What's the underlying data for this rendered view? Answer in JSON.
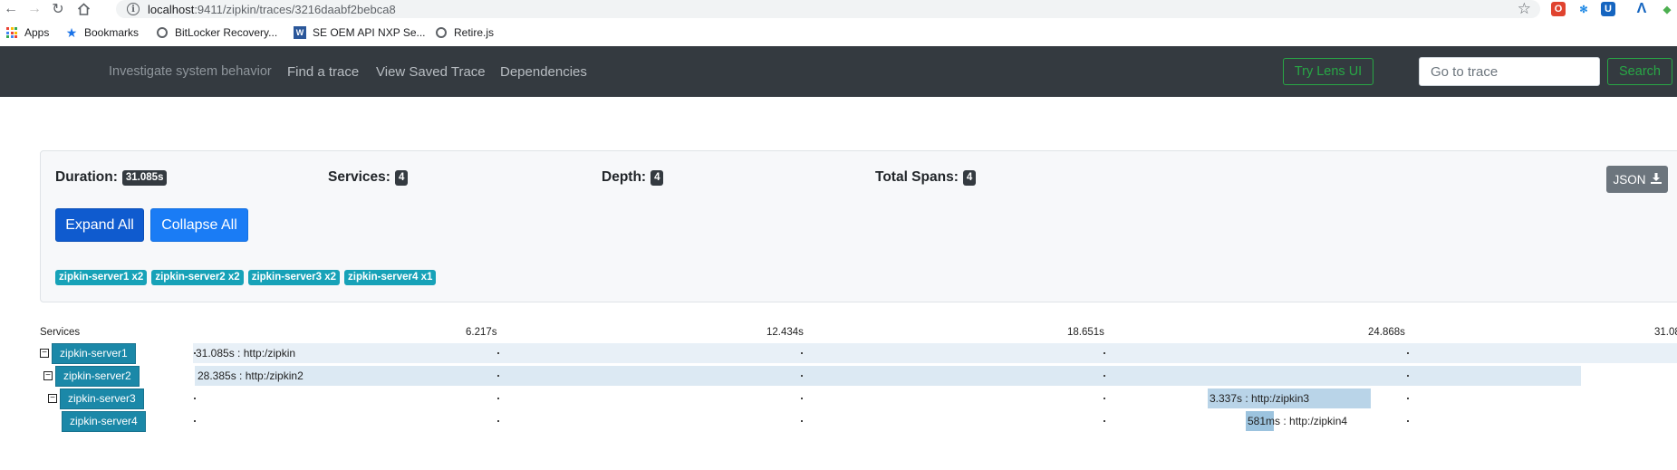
{
  "browser": {
    "url_host": "localhost",
    "url_path": ":9411/zipkin/traces/3216daabf2bebca8",
    "bookmarks": [
      "Apps",
      "Bookmarks",
      "BitLocker Recovery...",
      "SE OEM API NXP Se...",
      "Retire.js"
    ]
  },
  "nav": {
    "brand": "Investigate system behavior",
    "links": [
      "Find a trace",
      "View Saved Trace",
      "Dependencies"
    ],
    "lens_label": "Try Lens UI",
    "goto_placeholder": "Go to trace",
    "search_label": "Search"
  },
  "summary": {
    "duration_label": "Duration:",
    "duration_value": "31.085s",
    "services_label": "Services:",
    "services_value": "4",
    "depth_label": "Depth:",
    "depth_value": "4",
    "total_spans_label": "Total Spans:",
    "total_spans_value": "4",
    "json_label": "JSON",
    "expand_all_label": "Expand All",
    "collapse_all_label": "Collapse All",
    "service_badges": [
      "zipkin-server1 x2",
      "zipkin-server2 x2",
      "zipkin-server3 x2",
      "zipkin-server4 x1"
    ]
  },
  "timeline": {
    "services_header": "Services",
    "ticks": [
      "6.217s",
      "12.434s",
      "18.651s",
      "24.868s",
      "31.08"
    ],
    "rows": [
      {
        "service": "zipkin-server1",
        "collapsible": true,
        "label": "31.085s : http:/zipkin",
        "start": 0.0,
        "duration": 31.085
      },
      {
        "service": "zipkin-server2",
        "collapsible": true,
        "label": "28.385s : http:/zipkin2",
        "start": 0.0,
        "duration": 28.385
      },
      {
        "service": "zipkin-server3",
        "collapsible": true,
        "label": "3.337s : http:/zipkin3",
        "start": 20.75,
        "duration": 3.337
      },
      {
        "service": "zipkin-server4",
        "collapsible": false,
        "label": "581ms : http:/zipkin4",
        "start": 21.5,
        "duration": 0.581
      }
    ]
  },
  "colors": {
    "nav_bg": "#343a40",
    "lens_green": "#28a745",
    "primary_blue": "#0f5bcf",
    "badge_teal": "#17a2b8",
    "service_label": "#1b88a8",
    "span_row1": "#e8f0f7",
    "span_row2": "#dce9f3",
    "span_row3": "#b9d4e8",
    "span_row4": "#9cc3de"
  }
}
